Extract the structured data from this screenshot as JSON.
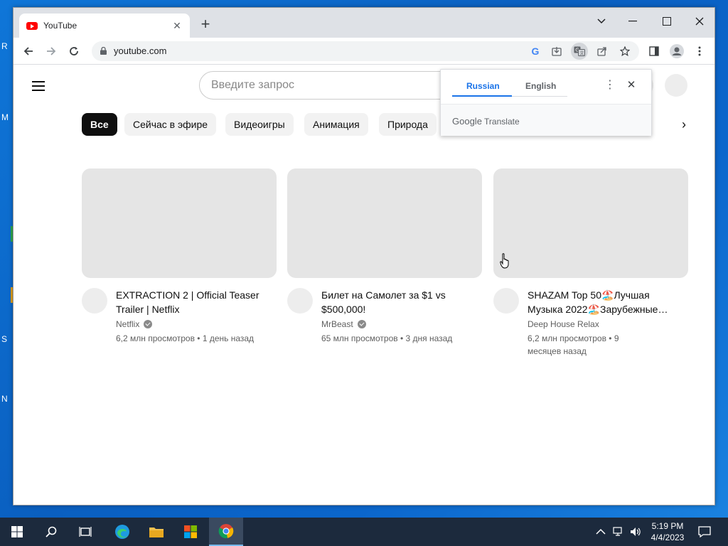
{
  "browser": {
    "tab_title": "YouTube",
    "url": "youtube.com"
  },
  "youtube": {
    "search_placeholder": "Введите запрос",
    "chips": [
      "Все",
      "Сейчас в эфире",
      "Видеоигры",
      "Анимация",
      "Природа"
    ],
    "videos": [
      {
        "title": "EXTRACTION 2 | Official Teaser Trailer | Netflix",
        "channel": "Netflix",
        "verified": true,
        "stats": "6,2 млн просмотров • 1 день назад"
      },
      {
        "title": "Билет на Самолет за $1 vs $500,000!",
        "channel": "MrBeast",
        "verified": true,
        "stats": "65 млн просмотров • 3 дня назад"
      },
      {
        "title": "SHAZAM Top 50🏖️Лучшая Музыка 2022🏖️Зарубежные…",
        "channel": "Deep House Relax",
        "verified": false,
        "stats": "6,2 млн просмотров • 9 месяцев назад"
      }
    ]
  },
  "translate_popup": {
    "source_lang": "Russian",
    "target_lang": "English",
    "brand_google": "Google",
    "brand_translate": "Translate"
  },
  "taskbar": {
    "time": "5:19 PM",
    "date": "4/4/2023"
  },
  "colors": {
    "accent_blue": "#1a73e8",
    "youtube_red": "#ff0000",
    "chip_active": "#0f0f0f"
  }
}
